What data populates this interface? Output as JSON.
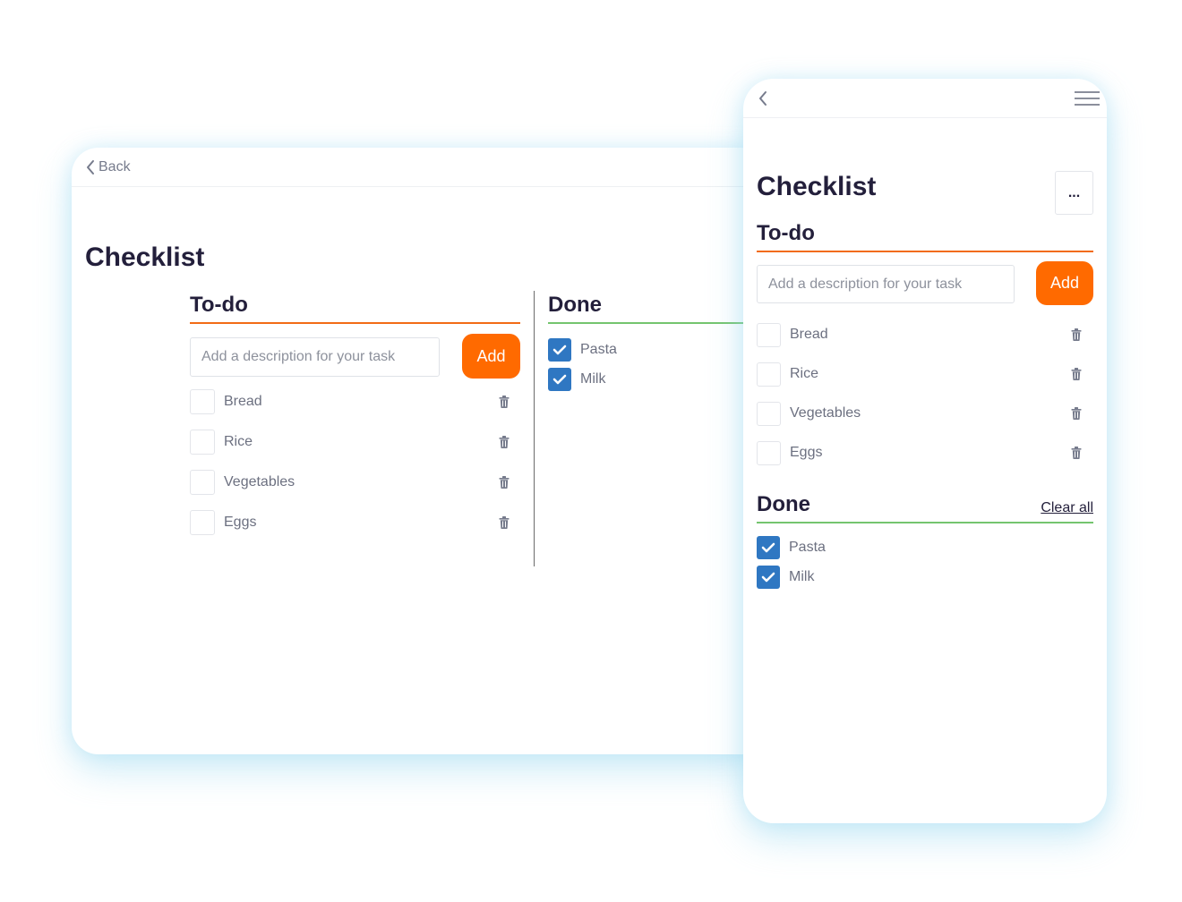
{
  "desktop": {
    "back_label": "Back",
    "title": "Checklist",
    "todo": {
      "heading": "To-do",
      "input_placeholder": "Add a description for your task",
      "add_label": "Add",
      "items": [
        {
          "label": "Bread",
          "checked": false
        },
        {
          "label": "Rice",
          "checked": false
        },
        {
          "label": "Vegetables",
          "checked": false
        },
        {
          "label": "Eggs",
          "checked": false
        }
      ]
    },
    "done": {
      "heading": "Done",
      "items": [
        {
          "label": "Pasta",
          "checked": true
        },
        {
          "label": "Milk",
          "checked": true
        }
      ]
    }
  },
  "mobile": {
    "title": "Checklist",
    "more_label": "...",
    "todo": {
      "heading": "To-do",
      "input_placeholder": "Add a description for your task",
      "add_label": "Add",
      "items": [
        {
          "label": "Bread",
          "checked": false
        },
        {
          "label": "Rice",
          "checked": false
        },
        {
          "label": "Vegetables",
          "checked": false
        },
        {
          "label": "Eggs",
          "checked": false
        }
      ]
    },
    "done": {
      "heading": "Done",
      "clear_all_label": "Clear all",
      "items": [
        {
          "label": "Pasta",
          "checked": true
        },
        {
          "label": "Milk",
          "checked": true
        }
      ]
    }
  },
  "icons": {
    "back": "chevron-left-icon",
    "menu": "hamburger-menu-icon",
    "delete": "trash-icon",
    "check": "checkmark-icon"
  },
  "colors": {
    "accent_orange": "#ff6a00",
    "todo_underline": "#f26b16",
    "done_underline": "#74c46e",
    "checkbox_checked": "#2f77c2",
    "title_text": "#231f3b",
    "item_text": "#6c7080"
  }
}
